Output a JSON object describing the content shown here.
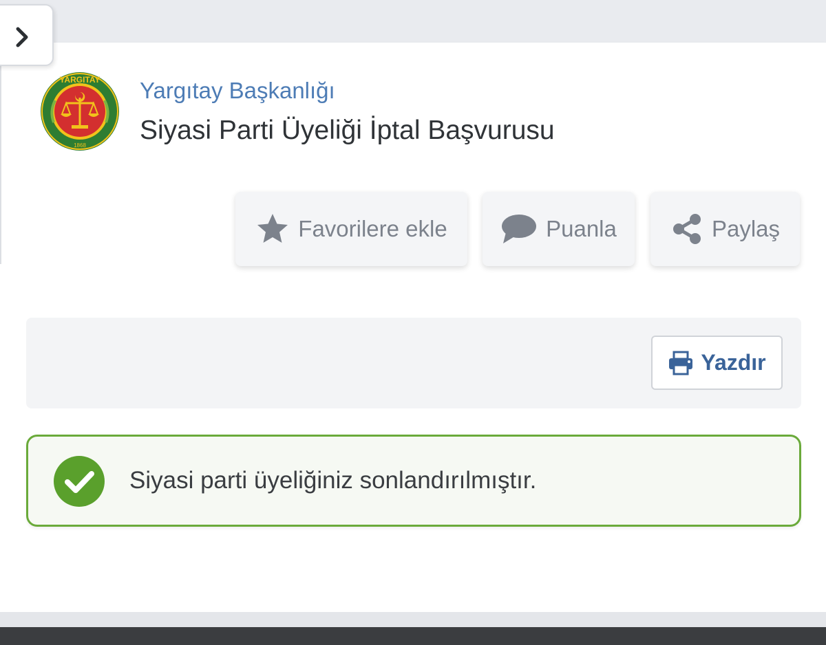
{
  "header": {
    "agency": "Yargıtay Başkanlığı",
    "title": "Siyasi Parti Üyeliği İptal Başvurusu"
  },
  "logo": {
    "text": "YARGITAY",
    "year": "1868",
    "colors": {
      "ring": "#2e7d32",
      "inner": "#f2c21b",
      "center": "#d32f2f"
    }
  },
  "actions": {
    "favorite": {
      "label": "Favorilere ekle",
      "icon": "star-icon"
    },
    "rate": {
      "label": "Puanla",
      "icon": "speech-bubble-icon"
    },
    "share": {
      "label": "Paylaş",
      "icon": "share-icon"
    }
  },
  "toolbar": {
    "print_label": "Yazdır",
    "print_icon": "printer-icon"
  },
  "alert": {
    "type": "success",
    "message": "Siyasi parti üyeliğiniz sonlandırılmıştır.",
    "color": "#6aaa3a"
  },
  "sidebar": {
    "toggle_icon": "chevron-right-icon"
  }
}
